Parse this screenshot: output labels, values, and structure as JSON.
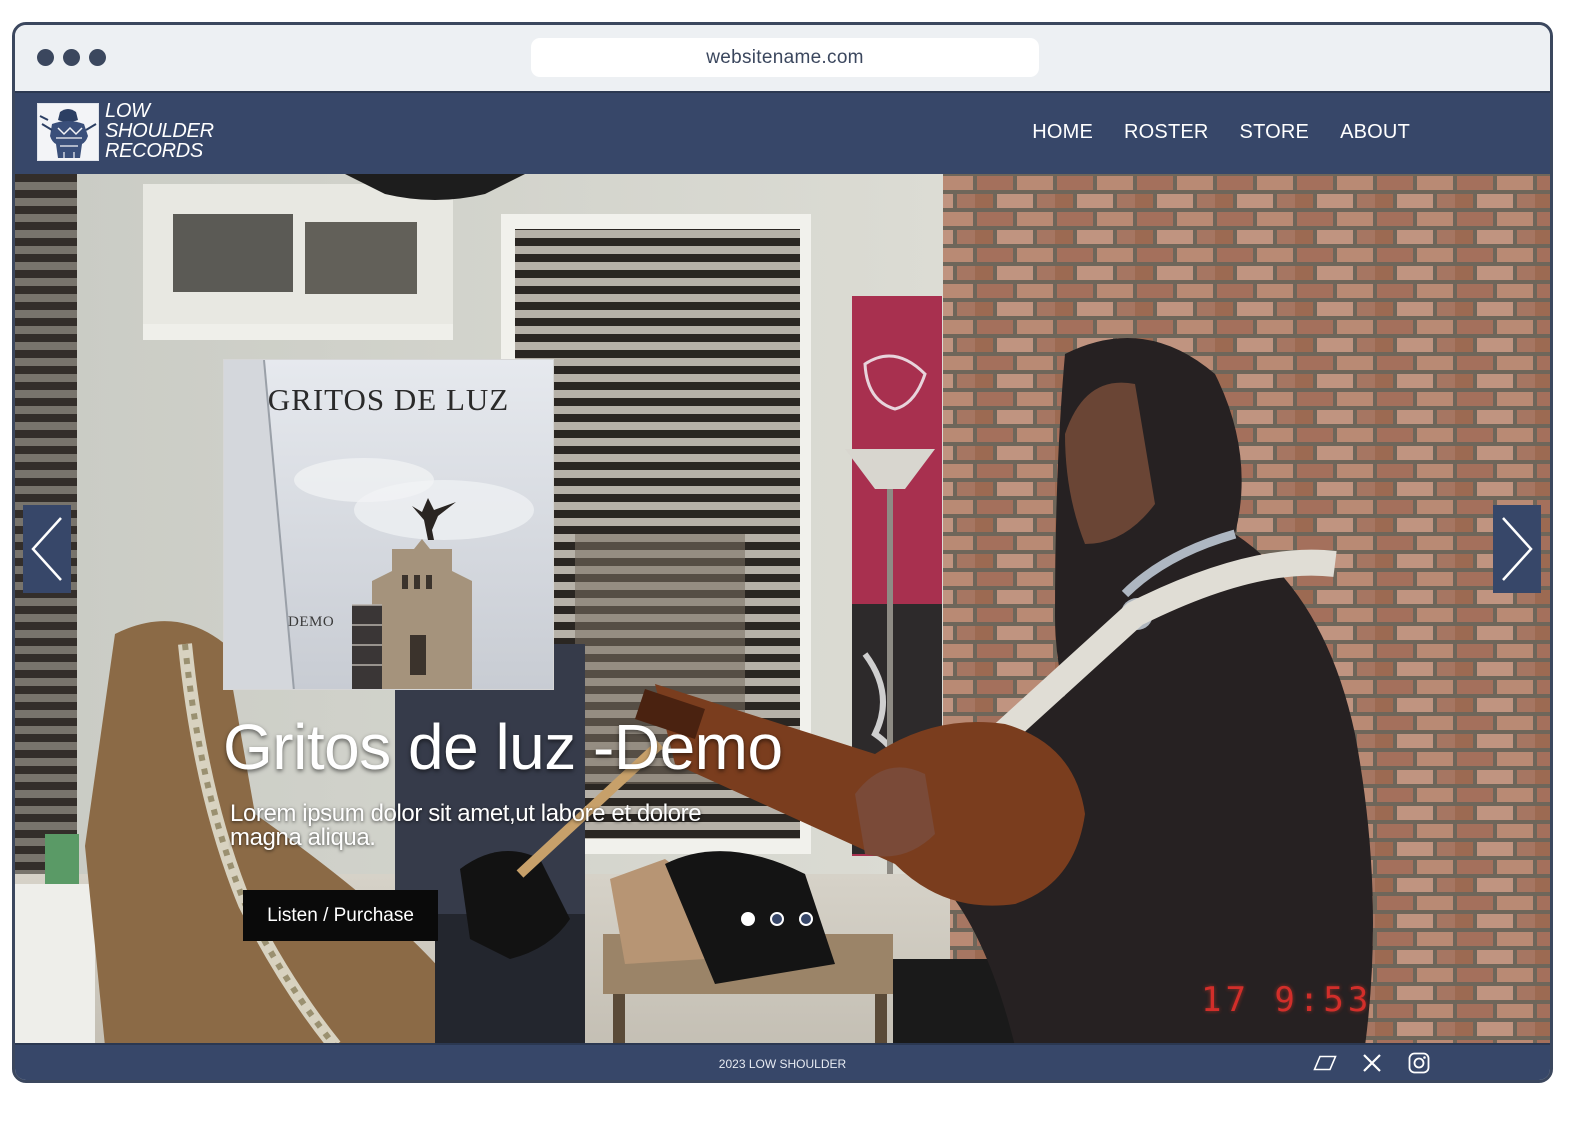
{
  "browser": {
    "url": "websitename.com"
  },
  "header": {
    "logo_lines": [
      "LOW",
      "SHOULDER",
      "RECORDS"
    ],
    "nav": [
      "HOME",
      "ROSTER",
      "STORE",
      "ABOUT"
    ]
  },
  "hero": {
    "album_cover": {
      "title": "GRITOS DE LUZ",
      "subtitle": "DEMO"
    },
    "title": "Gritos de luz -Demo",
    "description": "Lorem ipsum dolor sit amet,ut labore et dolore magna aliqua.",
    "cta_label": "Listen / Purchase",
    "photo_timestamp": "17 9:53",
    "carousel": {
      "slide_count": 3,
      "active_index": 0
    },
    "icons": {
      "prev": "chevron-left-icon",
      "next": "chevron-right-icon"
    }
  },
  "footer": {
    "text": "2023 LOW SHOULDER",
    "social_icons": [
      "bandcamp-icon",
      "x-icon",
      "instagram-icon"
    ]
  },
  "colors": {
    "brand_navy": "#374769",
    "frame": "#3b475e",
    "cta_bg": "#0a0a0a",
    "timestamp_red": "#e5302b"
  }
}
